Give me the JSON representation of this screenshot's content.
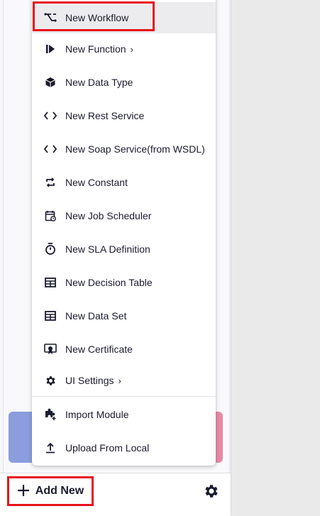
{
  "menu": {
    "items": [
      {
        "label": "New Workflow",
        "icon": "workflow-icon"
      },
      {
        "label": "New Function",
        "icon": "function-icon",
        "chevron": "›"
      },
      {
        "label": "New Data Type",
        "icon": "cube-icon"
      },
      {
        "label": "New Rest Service",
        "icon": "code-icon"
      },
      {
        "label": "New Soap Service(from WSDL)",
        "icon": "code-icon"
      },
      {
        "label": "New Constant",
        "icon": "repeat-icon"
      },
      {
        "label": "New Job Scheduler",
        "icon": "calendar-clock-icon"
      },
      {
        "label": "New SLA Definition",
        "icon": "stopwatch-icon"
      },
      {
        "label": "New Decision Table",
        "icon": "table-icon"
      },
      {
        "label": "New Data Set",
        "icon": "table-icon"
      },
      {
        "label": "New Certificate",
        "icon": "certificate-icon"
      },
      {
        "label": "UI Settings",
        "icon": "gear-icon",
        "chevron": "›"
      },
      {
        "label": "Import Module",
        "icon": "puzzle-plus-icon"
      },
      {
        "label": "Upload From Local",
        "icon": "upload-icon"
      }
    ]
  },
  "bottom_bar": {
    "add_new_label": "Add New",
    "add_new_icon": "plus-icon",
    "settings_icon": "gear-icon"
  },
  "colors": {
    "highlight": "#e8121a",
    "text": "#1b1b2f",
    "hover": "#ececef"
  }
}
